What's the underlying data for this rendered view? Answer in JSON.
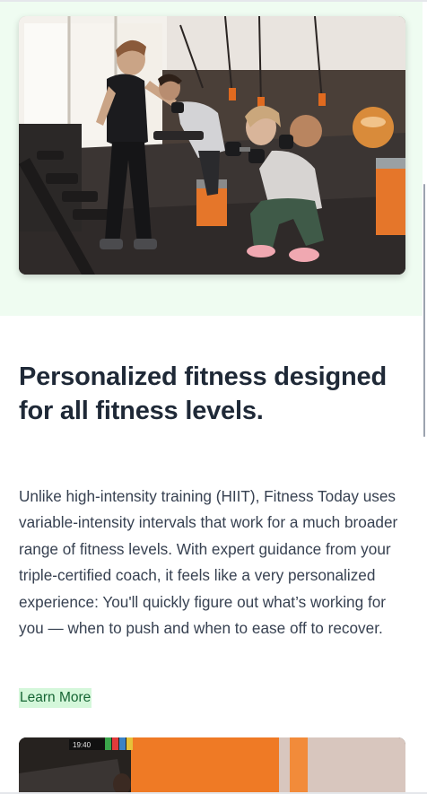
{
  "hero": {
    "image_label": "Group fitness class performing dumbbell squats in a gym"
  },
  "section": {
    "heading": "Personalized fitness designed for all fitness levels.",
    "body": "Unlike high-intensity training (HIIT), Fitness Today uses variable-intensity intervals that work for a much broader range of fitness levels. With expert guidance from your triple-certified coach, it feels like a very personalized experience: You'll quickly figure out what’s working for you — when to push and when to ease off to recover.",
    "cta_label": "Learn More"
  },
  "bottom_image": {
    "clock_text": "19:40"
  },
  "colors": {
    "hero_band": "#effcf1",
    "heading": "#1f2937",
    "body": "#374151",
    "cta_bg": "#d4f7da",
    "cta_text": "#166534",
    "accent_orange": "#f07a22"
  }
}
